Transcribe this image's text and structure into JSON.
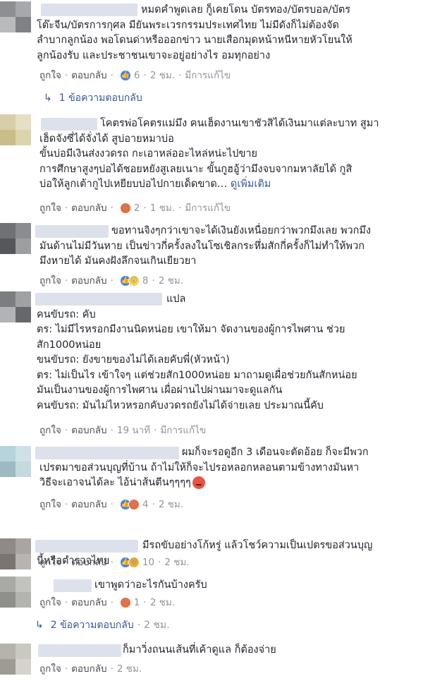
{
  "comments": [
    {
      "text": "หมดคำพูดเลย กู็เคยโดน บัตรทอง/บัตรบอล/บัตร\nโต๊ะจีน/บัตรการกุศล มียันพระเวรกรรมประเทศไทย ไม่มีดังก็ไม่ต้องจัด\nลำบากลูกน้อง พอโดนด่าหรือออกข่าว นายเสือกมุดหน้าหนีหายหัวโยนให้\nลูกน้องรับ และประชาชนเขาจะอยู่อย่างไร อมทุกอย่าง",
      "like": "ถูกใจ",
      "reply": "ตอบกลับ",
      "reactions": [
        "like-icon"
      ],
      "count": "6",
      "time": "2 ชม.",
      "edited": "มีการแก้ไข",
      "replies_label": "1 ข้อความตอบกลับ"
    },
    {
      "text": "โคตรพ่อโคตรแม่มึง คนเฮ็ดงานเขาชัวสิได้เงินมาแต่ละบาท สูมา\nเฮ็ดจังซี่ได้จั่งได้ สูบ่อายหมาบ่อ\nขั้นบ่อมีเงินส่งงวดรถ กะเอาหล่ออะไหล่หน่ะไปขาย\nการศึกษาสูงๆบ่อได้ชอยหยังสูเลยเนาะ ขั้นกูฮอู้ว่ามึงจบจากมหาลัยได้ กูสิ\nบ่อให้ลูกเต้ากูไปเหยียบบ่อไปกายเด็ดขาด…",
      "see_more": "ดูเพิ่มเติม",
      "like": "ถูกใจ",
      "reply": "ตอบกลับ",
      "reactions": [
        "angry-icon"
      ],
      "count": "2",
      "time": "1 ชม.",
      "edited": "มีการแก้ไข"
    },
    {
      "text": "ขอทานจิงๆกว่าเขาจะได้เงินยังเหนื่อยกว่าพวกมึงเลย พวกมึง\nมันด้านไม่มีวันหาย เป็นข่าวกี่ครั้งลงในโซเชิลกระหึ่มสักกี่ครั้งก็ไม่ทำให้พวก\nมึงหายได้ มันคงฝังลึกจนเกินเยียวยา",
      "like": "ถูกใจ",
      "reply": "ตอบกลับ",
      "reactions": [
        "like-icon",
        "wow-icon"
      ],
      "count": "8",
      "time": "2 ชม."
    },
    {
      "text": "แปล\nคนขับรถ: คับ\nตร: ไม่มีไรหรอกมีงานนิดหน่อย เขาให้มา จัดงานของผู้การไพศาน ช่วย\nสัก1000หน่อย\nขนขับรถ: ยังขายของไม่ได้เลยคับพี่(หัวหน้า)\nตร: ไม่เป็นไร เข้าใจๆ แต่ช่วยสัก1000หน่อย มาถามดูเผื่อช่วยกันสักหน่อย\nมันเป็นงานของผู้การไพศาน เผื่อผ่านไปผ่านมาจะดูแลกัน\nคนขับรถ: มันไม่ไหวหรอกคับงวดรถยังไม่ได้จ่ายเลย ประมาณนี้คับ",
      "like": "ถูกใจ",
      "reply": "ตอบกลับ",
      "time": "19 นาที",
      "edited": "มีการแก้ไข"
    },
    {
      "text": "ผมก็จะรอดูอีก 3 เดือนจะตัดอ้อย ก็จะมีพวก\nเปรตมาขอส่วนบุญที่บ้าน ถ้าไม่ให้ก็จะไปรอหลอกหลอนตามข้างทางมันหา\nวิธีจะเอาจนได้ละ ไอ้น่าส้นตีนๆๆๆๆ",
      "like": "ถูกใจ",
      "reply": "ตอบกลับ",
      "reactions": [
        "like-icon",
        "angry-icon"
      ],
      "count": "4",
      "time": "2 ชม."
    },
    {
      "text": "มีรถขับอย่างโก้หรู่ แล้วโชว์ความเป็นเปตรขอส่วนบุญ\nนี้หรือตำรวจไทย",
      "like": "ถูกใจ",
      "reply": "ตอบกลับ",
      "reactions": [
        "like-icon",
        "haha-icon"
      ],
      "count": "10",
      "time": "2 ชม."
    },
    {
      "text": "เขาพูดว่าอะไรกันบ้างครับ",
      "like": "ถูกใจ",
      "reply": "ตอบกลับ",
      "reactions": [
        "angry-icon"
      ],
      "count": "1",
      "time": "2 ชม.",
      "replies_label": "2 ข้อความตอบกลับ",
      "replies_time": "2 ชม."
    },
    {
      "text": "ก็มาวิ่งถนนเส้นที่เค้าดูแล ก็ต้องจ่าย",
      "like": "ถูกใจ",
      "reply": "ตอบกลับ",
      "time": "2 ชม."
    }
  ]
}
